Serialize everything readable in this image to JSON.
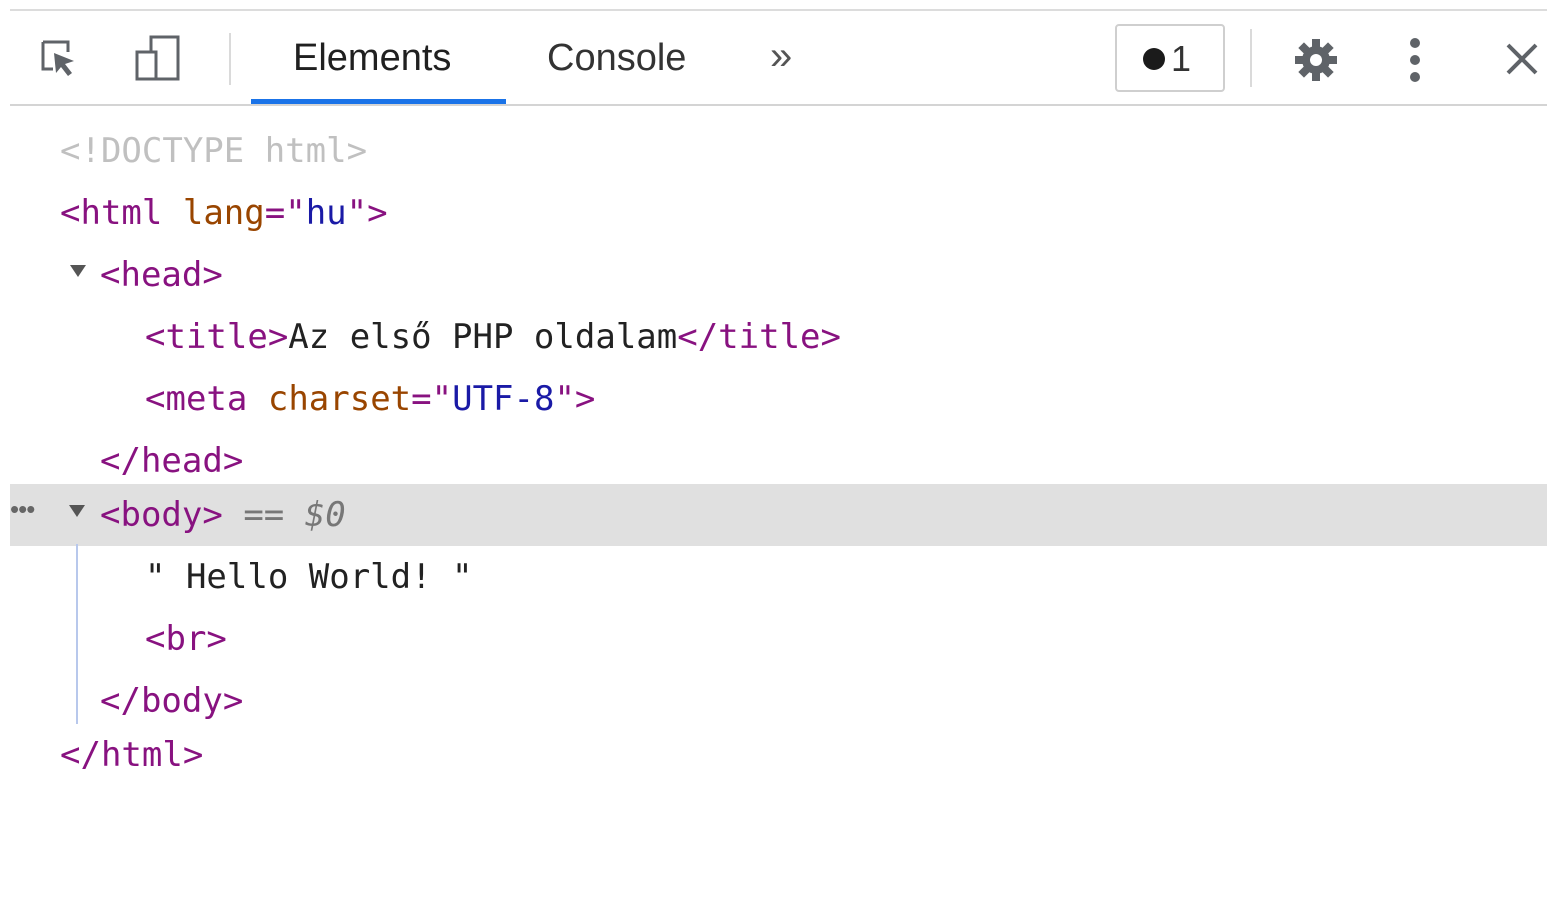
{
  "toolbar": {
    "inspect_icon": "inspect-element-icon",
    "device_icon": "device-toolbar-icon",
    "tabs": [
      {
        "label": "Elements",
        "active": true
      },
      {
        "label": "Console",
        "active": false
      }
    ],
    "more_tabs_label": "»",
    "issues_count": "1",
    "settings_icon": "gear-icon",
    "menu_icon": "kebab-menu-icon",
    "close_icon": "close-icon",
    "accent_color": "#1a73e8"
  },
  "dom": {
    "doctype": "<!DOCTYPE html>",
    "html_open_tag": "<html",
    "html_attr_name": "lang",
    "html_attr_eq": "=\"",
    "html_attr_value": "hu",
    "html_attr_close": "\">",
    "head_open": "<head>",
    "title_open": "<title>",
    "title_text": "Az első PHP oldalam",
    "title_close": "</title>",
    "meta_open_tag": "<meta",
    "meta_attr_name": "charset",
    "meta_attr_eq": "=\"",
    "meta_attr_value": "UTF-8",
    "meta_attr_close": "\">",
    "head_close": "</head>",
    "body_ellipsis": "•••",
    "body_open": "<body>",
    "body_selected_marker": "== $0",
    "body_text": "\" Hello World! \"",
    "br_tag": "<br>",
    "body_close": "</body>",
    "html_close": "</html>"
  },
  "colors": {
    "tag": "#881280",
    "attribute_name": "#994500",
    "attribute_value": "#1a1aa6",
    "doctype": "#c0c0c0",
    "selected_row_bg": "#e0e0e0"
  }
}
